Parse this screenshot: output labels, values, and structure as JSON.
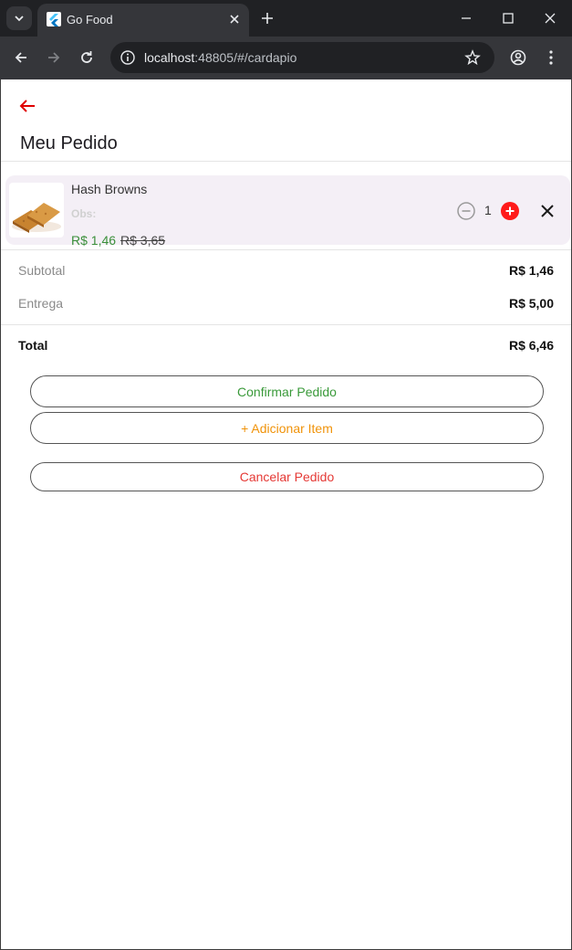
{
  "browser": {
    "tab_title": "Go Food",
    "url_host": "localhost",
    "url_path": ":48805/#/cardapio"
  },
  "page": {
    "title": "Meu Pedido"
  },
  "order_item": {
    "name": "Hash Browns",
    "obs_label": "Obs:",
    "price": "R$ 1,46",
    "old_price": "R$ 3,65",
    "quantity": "1"
  },
  "summary": {
    "subtotal_label": "Subtotal",
    "subtotal_value": "R$ 1,46",
    "delivery_label": "Entrega",
    "delivery_value": "R$ 5,00",
    "total_label": "Total",
    "total_value": "R$ 6,46"
  },
  "actions": {
    "confirm_label": "Confirmar Pedido",
    "add_label": "+ Adicionar Item",
    "cancel_label": "Cancelar Pedido"
  },
  "colors": {
    "back_arrow": "#e00000",
    "price_green": "#3a8f3a",
    "confirm_green": "#3a9a3a",
    "add_orange": "#f0930a",
    "cancel_red": "#e53935",
    "plus_red": "#ff1a1a",
    "item_bg": "#f4eff6"
  }
}
